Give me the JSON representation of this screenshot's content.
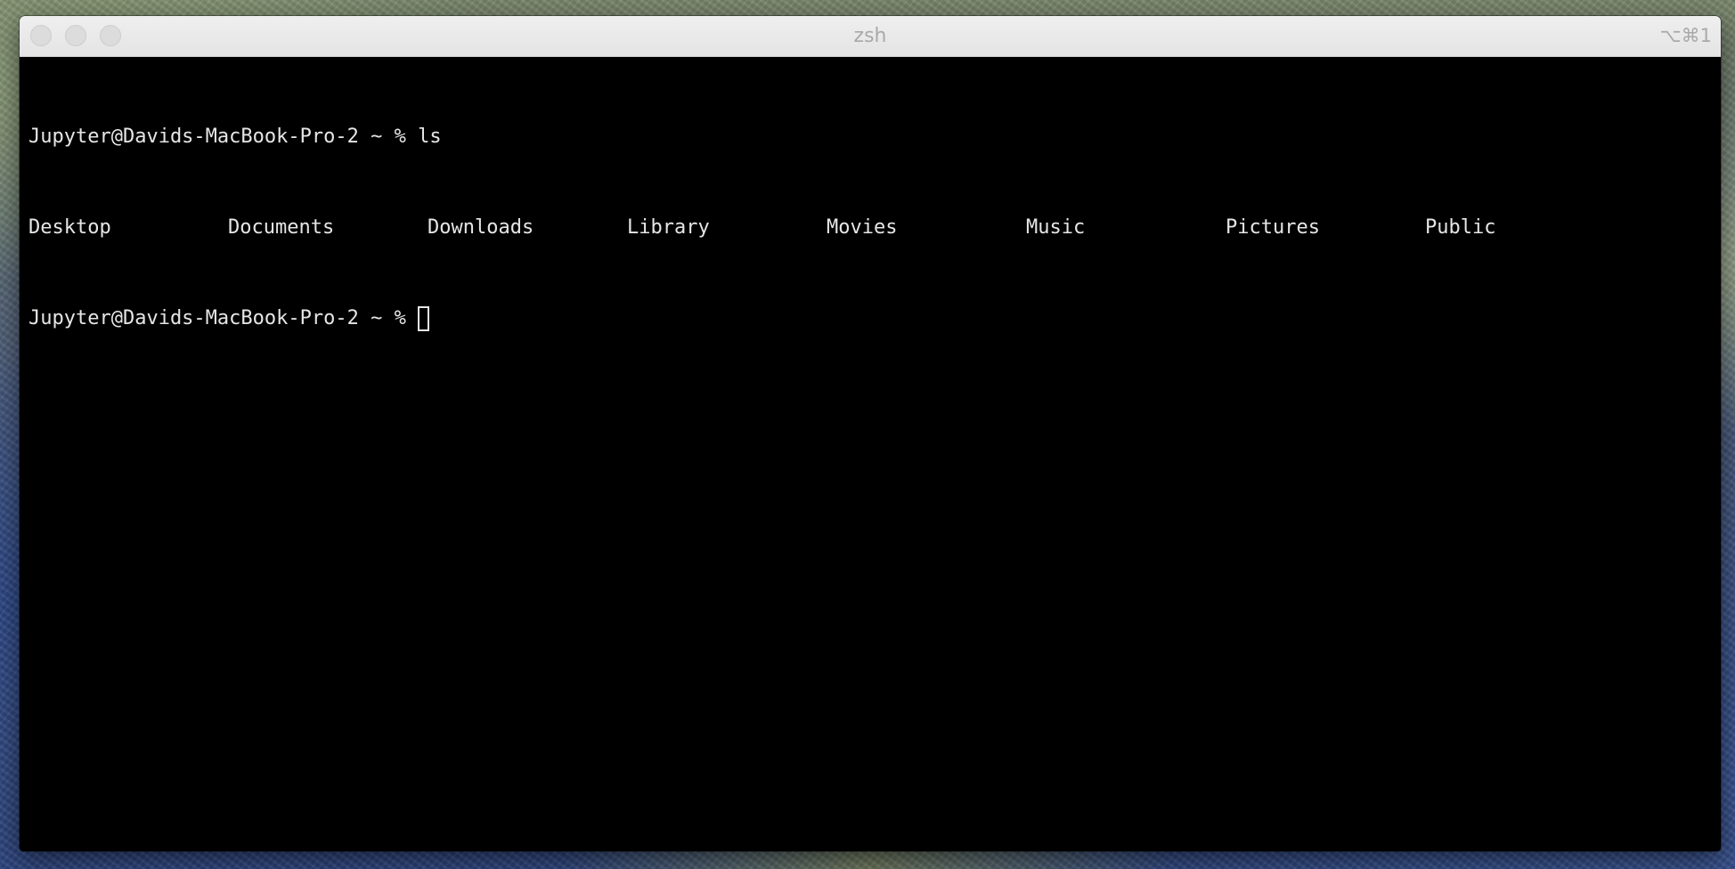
{
  "window": {
    "title": "zsh",
    "shortcut": "⌥⌘1"
  },
  "terminal": {
    "prompt_line_1": {
      "prompt": "Jupyter@Davids-MacBook-Pro-2 ~ %",
      "command": "ls"
    },
    "ls_output": [
      "Desktop",
      "Documents",
      "Downloads",
      "Library",
      "Movies",
      "Music",
      "Pictures",
      "Public"
    ],
    "prompt_line_2": {
      "prompt": "Jupyter@Davids-MacBook-Pro-2 ~ %"
    }
  },
  "colors": {
    "terminal_background": "#000000",
    "terminal_text": "#e6e6e6",
    "titlebar": "#e8e8e8",
    "title_text": "#a9a9a9"
  }
}
